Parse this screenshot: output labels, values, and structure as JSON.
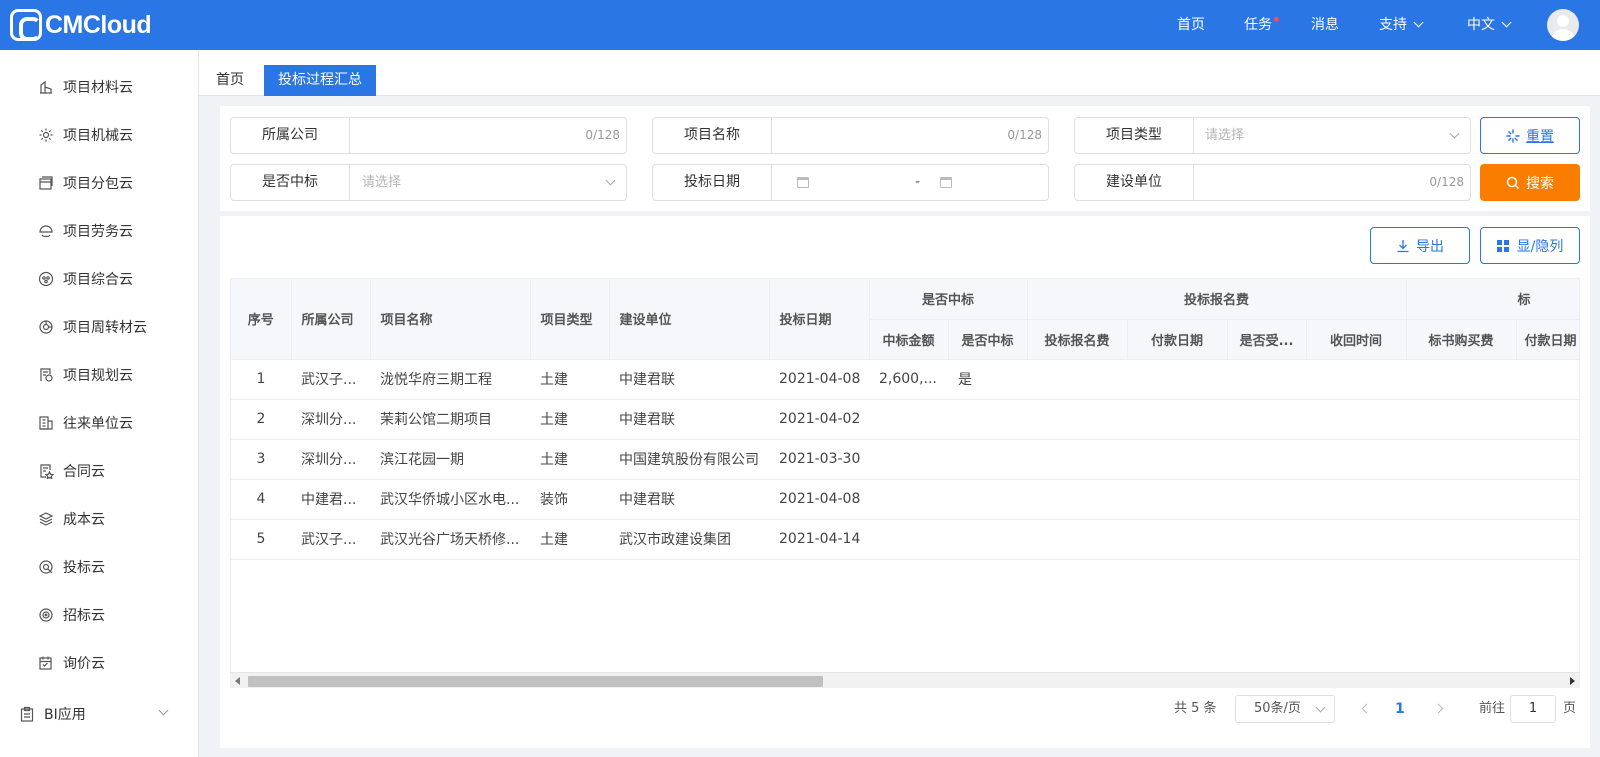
{
  "app": {
    "logo_text": "CMCloud"
  },
  "topnav": {
    "home": "首页",
    "tasks": "任务",
    "messages": "消息",
    "support": "支持",
    "language": "中文"
  },
  "sidebar": {
    "items": [
      {
        "label": "项目材料云",
        "icon": "material-icon"
      },
      {
        "label": "项目机械云",
        "icon": "gear-icon"
      },
      {
        "label": "项目分包云",
        "icon": "window-icon"
      },
      {
        "label": "项目劳务云",
        "icon": "helmet-icon"
      },
      {
        "label": "项目综合云",
        "icon": "cluster-icon"
      },
      {
        "label": "项目周转材云",
        "icon": "cycle-icon"
      },
      {
        "label": "项目规划云",
        "icon": "plan-icon"
      },
      {
        "label": "往来单位云",
        "icon": "building-icon"
      },
      {
        "label": "合同云",
        "icon": "contract-icon"
      },
      {
        "label": "成本云",
        "icon": "layers-icon"
      },
      {
        "label": "投标云",
        "icon": "bid-icon"
      },
      {
        "label": "招标云",
        "icon": "target-icon"
      },
      {
        "label": "询价云",
        "icon": "calendar-icon"
      }
    ],
    "bi": {
      "label": "BI应用",
      "icon": "clipboard-icon"
    }
  },
  "tabs": [
    {
      "label": "首页"
    },
    {
      "label": "投标过程汇总",
      "active": true
    }
  ],
  "filters": {
    "company": {
      "label": "所属公司",
      "count": "0/128"
    },
    "project_name": {
      "label": "项目名称",
      "count": "0/128"
    },
    "project_type": {
      "label": "项目类型",
      "placeholder": "请选择"
    },
    "won": {
      "label": "是否中标",
      "placeholder": "请选择"
    },
    "bid_date": {
      "label": "投标日期",
      "separator": "-"
    },
    "builder": {
      "label": "建设单位",
      "count": "0/128"
    }
  },
  "buttons": {
    "reset": "重置",
    "search": "搜索",
    "export": "导出",
    "toggle_columns": "显/隐列"
  },
  "table": {
    "headers": {
      "seq": "序号",
      "company": "所属公司",
      "project": "项目名称",
      "type": "项目类型",
      "builder": "建设单位",
      "date": "投标日期",
      "group_won": "是否中标",
      "group_fee": "投标报名费",
      "group_doc": "标",
      "won_amount": "中标金额",
      "won_flag": "是否中标",
      "fee": "投标报名费",
      "pay_date": "付款日期",
      "received": "是否受...",
      "return_time": "收回时间",
      "doc_fee": "标书购买费",
      "doc_pay_date": "付款日期"
    },
    "rows": [
      {
        "seq": "1",
        "company": "武汉子...",
        "project": "泷悦华府三期工程",
        "type": "土建",
        "builder": "中建君联",
        "date": "2021-04-08",
        "won_amount": "2,600,...",
        "won_flag": "是"
      },
      {
        "seq": "2",
        "company": "深圳分...",
        "project": "茉莉公馆二期项目",
        "type": "土建",
        "builder": "中建君联",
        "date": "2021-04-02",
        "won_amount": "",
        "won_flag": ""
      },
      {
        "seq": "3",
        "company": "深圳分...",
        "project": "滨江花园一期",
        "type": "土建",
        "builder": "中国建筑股份有限公司",
        "date": "2021-03-30",
        "won_amount": "",
        "won_flag": ""
      },
      {
        "seq": "4",
        "company": "中建君...",
        "project": "武汉华侨城小区水电...",
        "type": "装饰",
        "builder": "中建君联",
        "date": "2021-04-08",
        "won_amount": "",
        "won_flag": ""
      },
      {
        "seq": "5",
        "company": "武汉子...",
        "project": "武汉光谷广场天桥修...",
        "type": "土建",
        "builder": "武汉市政建设集团",
        "date": "2021-04-14",
        "won_amount": "",
        "won_flag": ""
      }
    ]
  },
  "pagination": {
    "total": "共 5 条",
    "page_size": "50条/页",
    "current": "1",
    "goto_prefix": "前往",
    "goto_value": "1",
    "goto_suffix": "页"
  },
  "colors": {
    "primary": "#2a76e4",
    "search": "#fa7d00"
  }
}
